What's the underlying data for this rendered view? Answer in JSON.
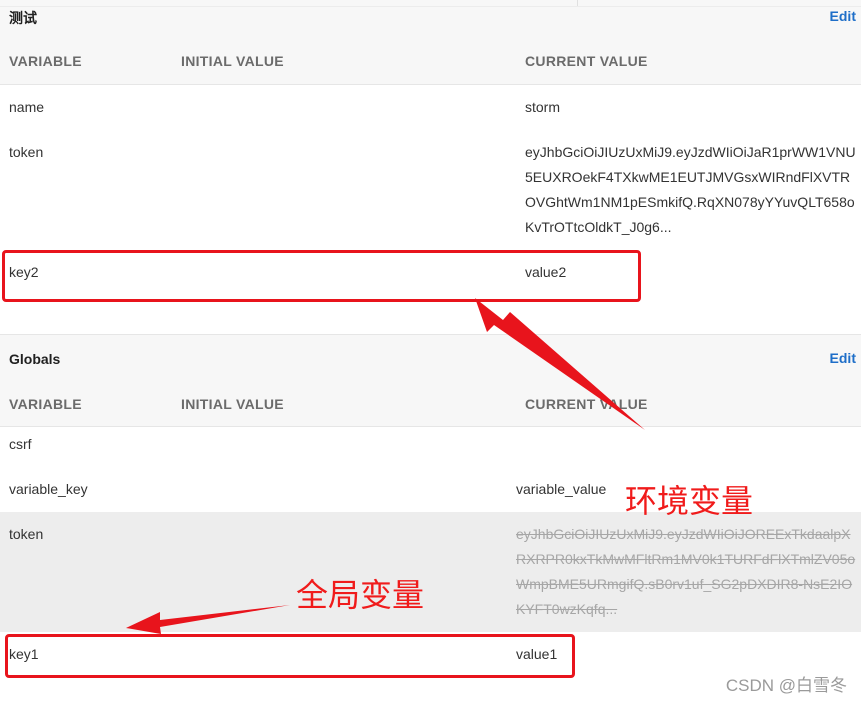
{
  "env_section": {
    "title": "测试",
    "edit_label": "Edit",
    "columns": [
      "VARIABLE",
      "INITIAL VALUE",
      "CURRENT VALUE"
    ],
    "rows": [
      {
        "variable": "name",
        "initial": "",
        "current": "storm"
      },
      {
        "variable": "token",
        "initial": "",
        "current": "eyJhbGciOiJIUzUxMiJ9.eyJzdWIiOiJaR1prWW1VNU5EUXROekF4TXkwME1EUTJMVGsxWIRndFlXVTROVGhtWm1NM1pESmkifQ.RqXN078yYYuvQLT658oKvTrOTtcOldkT_J0g6..."
      },
      {
        "variable": "key2",
        "initial": "",
        "current": "value2"
      }
    ]
  },
  "globals_section": {
    "title": "Globals",
    "edit_label": "Edit",
    "columns": [
      "VARIABLE",
      "INITIAL VALUE",
      "CURRENT VALUE"
    ],
    "rows": [
      {
        "variable": "csrf",
        "initial": "",
        "current": ""
      },
      {
        "variable": "variable_key",
        "initial": "",
        "current": "variable_value"
      },
      {
        "variable": "token",
        "initial": "",
        "current": "eyJhbGciOiJIUzUxMiJ9.eyJzdWIiOiJOREExTkdaalpXRXRPR0kxTkMwMFltRm1MV0k1TURFdFlXTmlZV05oWmpBME5URmgifQ.sB0rv1uf_SG2pDXDIR8-NsE2IOKYFT0wzKqfq...",
        "overridden": true
      },
      {
        "variable": "key1",
        "initial": "",
        "current": "value1"
      }
    ]
  },
  "annotations": {
    "env_label": "环境变量",
    "global_label": "全局变量",
    "color": "#e8141c"
  },
  "watermark": "CSDN @白雪冬",
  "colors": {
    "edit_link": "#1e6ec8",
    "header_bg": "#f7f7f7",
    "override_row_bg": "#ededed"
  }
}
